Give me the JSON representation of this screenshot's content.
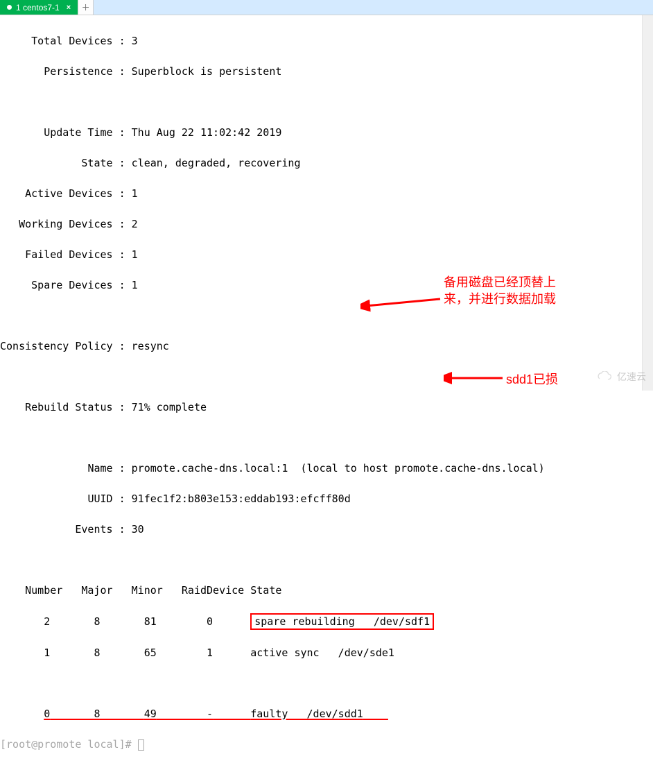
{
  "tab": {
    "label": "1 centos7-1"
  },
  "mdadm": {
    "fields": [
      {
        "label": "Total Devices",
        "value": "3"
      },
      {
        "label": "Persistence",
        "value": "Superblock is persistent"
      },
      {
        "label": "Update Time",
        "value": "Thu Aug 22 11:02:42 2019"
      },
      {
        "label": "State",
        "value": "clean, degraded, recovering"
      },
      {
        "label": "Active Devices",
        "value": "1"
      },
      {
        "label": "Working Devices",
        "value": "2"
      },
      {
        "label": "Failed Devices",
        "value": "1"
      },
      {
        "label": "Spare Devices",
        "value": "1"
      },
      {
        "label": "Consistency Policy",
        "value": "resync"
      },
      {
        "label": "Rebuild Status",
        "value": "71% complete"
      },
      {
        "label": "Name",
        "value": "promote.cache-dns.local:1  (local to host promote.cache-dns.local)"
      },
      {
        "label": "UUID",
        "value": "91fec1f2:b803e153:eddab193:efcff80d"
      },
      {
        "label": "Events",
        "value": "30"
      }
    ],
    "table_header": {
      "c0": "Number",
      "c1": "Major",
      "c2": "Minor",
      "c3": "RaidDevice",
      "c4": "State"
    },
    "rows": [
      {
        "num": "2",
        "major": "8",
        "minor": "81",
        "raid": "0",
        "state": "spare rebuilding   /dev/sdf1"
      },
      {
        "num": "1",
        "major": "8",
        "minor": "65",
        "raid": "1",
        "state": "active sync   /dev/sde1"
      },
      {
        "num": "0",
        "major": "8",
        "minor": "49",
        "raid": "-",
        "state": "faulty   /dev/sdd1"
      }
    ]
  },
  "annotations": {
    "right1_l1": "备用磁盘已经顶替上",
    "right1_l2": "来，并进行数据加载",
    "right2": "sdd1已损"
  },
  "watermark": "亿速云"
}
